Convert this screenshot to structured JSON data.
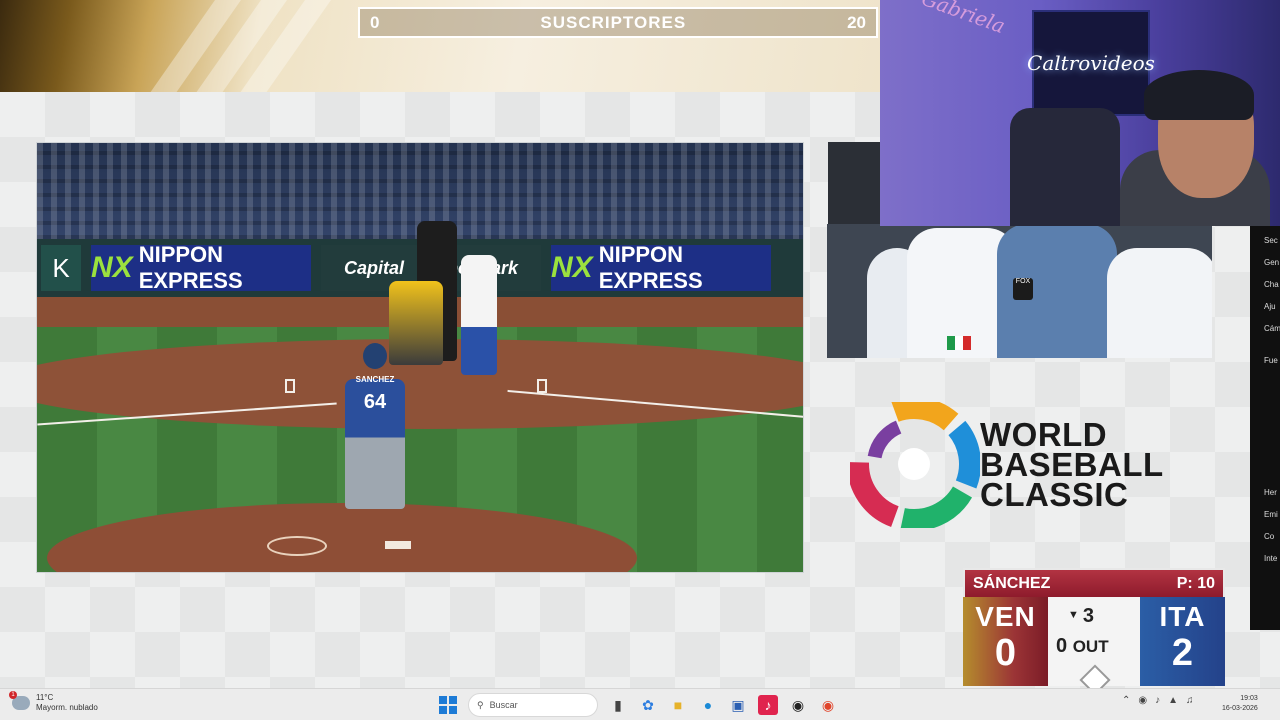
{
  "subscribers_bar": {
    "left_count": "0",
    "title": "SUSCRIPTORES",
    "right_count": "20"
  },
  "game_feed": {
    "ads": {
      "nippon_brand": "NX",
      "nippon_text": "NIPPON EXPRESS",
      "capital_text": "Capital",
      "depot_text": "Depot park",
      "left_edge_letter": "K"
    },
    "pitcher": {
      "name": "SANCHEZ",
      "number": "64"
    }
  },
  "webcam": {
    "neon_sign": "Caltrovideos",
    "wall_text": "Gabriela"
  },
  "interview_feed": {
    "mic_label": "FOX"
  },
  "side_menu": {
    "items": [
      "Sec",
      "Gen",
      "Cha",
      "Aju",
      "Cám",
      "Fue",
      "Her",
      "Emi",
      "Co",
      "Inte"
    ]
  },
  "wbc_logo": {
    "line1": "WORLD",
    "line2": "BASEBALL",
    "line3": "CLASSIC",
    "colors": [
      "#f2a51c",
      "#1f8fd9",
      "#20b26b",
      "#d62c52",
      "#7a3fa0"
    ]
  },
  "scoreboard": {
    "pitcher_name": "SÁNCHEZ",
    "pitch_count": "P: 10",
    "away_team": "VEN",
    "away_score": "0",
    "home_team": "ITA",
    "home_score": "2",
    "inning_arrow": "▼",
    "inning": "3",
    "outs": "0",
    "outs_label": "OUT"
  },
  "taskbar": {
    "weather_temp": "11°C",
    "weather_desc": "Mayorm. nublado",
    "notification_badge": "1",
    "search_placeholder": "Buscar",
    "time": "19:03",
    "date": "16-03-2026"
  }
}
